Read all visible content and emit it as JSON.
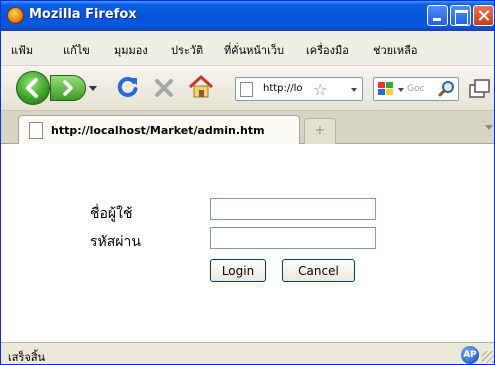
{
  "window": {
    "title": "Mozilla Firefox",
    "accent": "#0754d9",
    "icons": {
      "app": "firefox-icon",
      "minimize": "minimize-icon",
      "maximize": "maximize-icon",
      "close": "close-icon"
    }
  },
  "menu": {
    "items": [
      "แฟ้ม",
      "แก้ไข",
      "มุมมอง",
      "ประวัติ",
      "ที่คั่นหน้าเว็บ",
      "เครื่องมือ",
      "ช่วยเหลือ"
    ]
  },
  "toolbar": {
    "url": "http://lo",
    "search_placeholder": "Goc",
    "icons": {
      "back": "back-arrow-icon",
      "forward": "forward-arrow-icon",
      "history": "chevron-down-icon",
      "reload": "reload-icon",
      "stop": "stop-icon",
      "home": "home-icon",
      "page": "page-icon",
      "bookmark": "star-icon",
      "search_engine": "google-icon",
      "search": "magnifier-icon"
    }
  },
  "tabs": [
    {
      "title": "http://localhost/Market/admin.htm",
      "icon": "page-icon"
    }
  ],
  "new_tab_label": "+",
  "login": {
    "username_label": "ชื่อผู้ใช้",
    "password_label": "รหัสผ่าน",
    "username_value": "",
    "password_value": "",
    "login_button": "Login",
    "cancel_button": "Cancel"
  },
  "status": {
    "text": "เสร็จสิ้น",
    "icon_label": "AP"
  }
}
